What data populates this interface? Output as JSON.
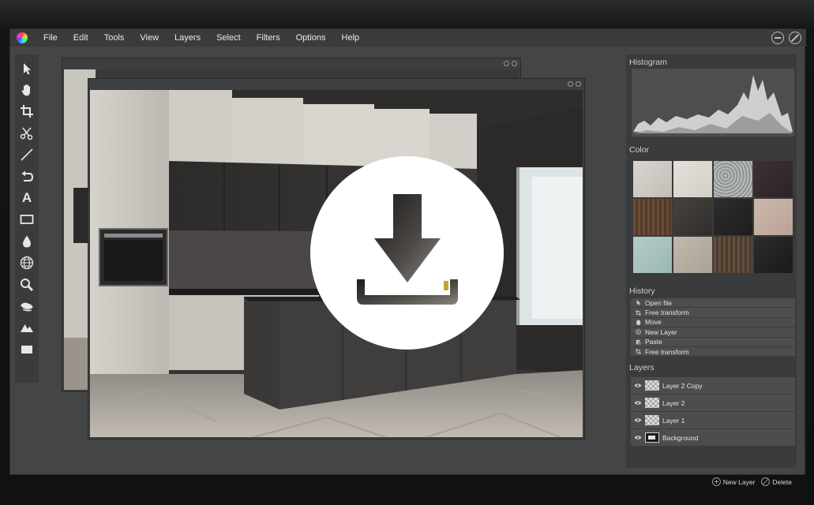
{
  "menubar": {
    "items": [
      "File",
      "Edit",
      "Tools",
      "View",
      "Layers",
      "Select",
      "Filters",
      "Options",
      "Help"
    ]
  },
  "tools": [
    {
      "icon": "pointer-icon"
    },
    {
      "icon": "hand-icon"
    },
    {
      "icon": "crop-icon"
    },
    {
      "icon": "scissors-icon"
    },
    {
      "icon": "line-icon"
    },
    {
      "icon": "undo-icon"
    },
    {
      "icon": "text-icon",
      "glyph": "A"
    },
    {
      "icon": "rectangle-icon"
    },
    {
      "icon": "drop-icon"
    },
    {
      "icon": "globe-icon"
    },
    {
      "icon": "magnifier-icon"
    },
    {
      "icon": "smudge-icon"
    },
    {
      "icon": "mountain-icon"
    },
    {
      "icon": "fill-rect-icon"
    }
  ],
  "panels": {
    "histogram_title": "Histogram",
    "color_title": "Color",
    "history_title": "History",
    "layers_title": "Layers"
  },
  "swatches": [
    "#cfcac4",
    "#dedad2",
    "#a8acac",
    "#3a2e30",
    "#5e4330",
    "#3c3a38",
    "#2a2828",
    "#c4b0a2",
    "#a8c4c0",
    "#b8b0a4",
    "#5a4838",
    "#262626"
  ],
  "history": [
    {
      "icon": "pointer-icon",
      "label": "Open file"
    },
    {
      "icon": "crop-icon",
      "label": "Free transform"
    },
    {
      "icon": "hand-icon",
      "label": "Move"
    },
    {
      "icon": "new-layer-icon",
      "label": "New Layer"
    },
    {
      "icon": "paste-icon",
      "label": "Paste"
    },
    {
      "icon": "crop-icon",
      "label": "Free transform"
    }
  ],
  "layers": [
    {
      "label": "Layer 2 Copy",
      "thumb": "transparent"
    },
    {
      "label": "Layer 2",
      "thumb": "transparent"
    },
    {
      "label": "Layer 1",
      "thumb": "transparent"
    },
    {
      "label": "Background",
      "thumb": "image"
    }
  ],
  "layer_actions": {
    "new_layer": "New Layer",
    "delete": "Delete"
  },
  "colors": {
    "app_bg": "#444546",
    "panel_bg": "#3a3b3c",
    "row_bg": "#4c4d4e",
    "overlay": "#ffffff"
  }
}
